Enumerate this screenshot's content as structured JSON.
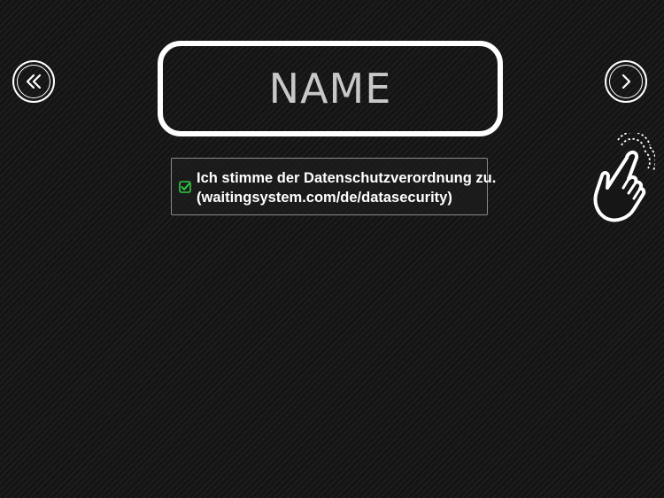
{
  "name_field": {
    "value": "NAME"
  },
  "consent": {
    "checked": true,
    "line1": "Ich stimme der Datenschutzverordnung zu.",
    "line2": "(waitingsystem.com/de/datasecurity)",
    "check_color": "#2ecc40"
  },
  "icons": {
    "back": "double-chevron-left-icon",
    "next": "chevron-right-icon",
    "hint": "tap-hand-icon"
  }
}
